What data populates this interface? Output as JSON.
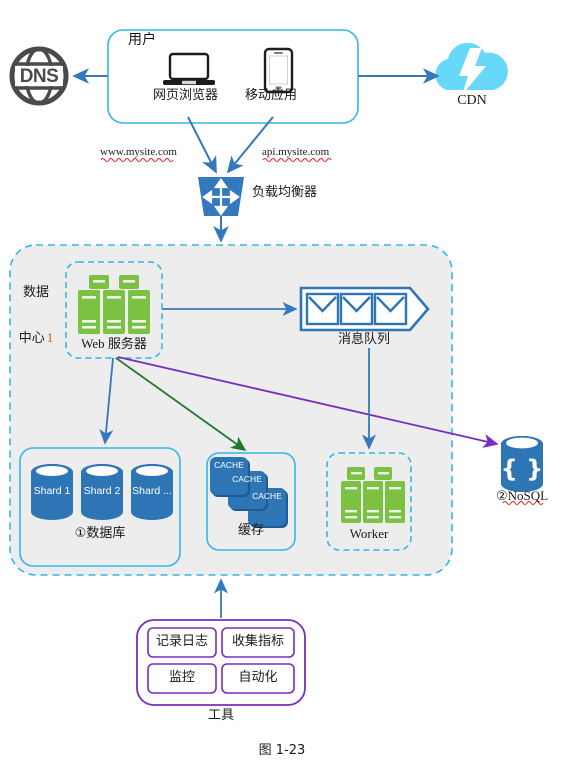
{
  "figure": {
    "caption": "图 1-23",
    "caption_prefix": "图",
    "caption_number": "1-23"
  },
  "colors": {
    "accent_blue": "#3478bd",
    "light_blue_border": "#35b6e8",
    "cyan_dashed": "#35b6e8",
    "server_green": "#7cc242",
    "db_blue": "#2e75b6",
    "cdn_cloud": "#67d8f8",
    "dns_gray": "#4a4a4a",
    "purple": "#7b2bbf",
    "green_arrow": "#1f7a30",
    "datacenter_fill": "#ededed",
    "spellcheck_red": "#e01b1b",
    "number_orange": "#c55a11"
  },
  "nodes": {
    "dns": {
      "label": "DNS",
      "icon": "globe-icon"
    },
    "users_group": {
      "title": "用户",
      "clients": [
        {
          "label": "网页浏览器",
          "icon": "laptop-icon"
        },
        {
          "label": "移动应用",
          "icon": "smartphone-icon"
        }
      ]
    },
    "cdn": {
      "label": "CDN",
      "icon": "cloud-lightning-icon"
    },
    "urls": [
      {
        "text": "www.mysite.com",
        "spellcheck_flag": true
      },
      {
        "text": "api.mysite.com",
        "spellcheck_flag": true
      }
    ],
    "load_balancer": {
      "label": "负载均衡器",
      "icon": "load-balancer-icon"
    },
    "datacenter": {
      "label_line1": "数据",
      "label_line2": "中心",
      "label_number": "1"
    },
    "web_server": {
      "label": "Web 服务器",
      "icon": "server-rack-icon"
    },
    "message_queue": {
      "label": "消息队列",
      "icon": "queue-envelopes-icon",
      "envelope_count": 3
    },
    "database": {
      "label": "①数据库",
      "marker": "①",
      "name": "数据库",
      "shards": [
        "Shard 1",
        "Shard 2",
        "Shard ..."
      ]
    },
    "cache": {
      "label": "缓存",
      "tiles": [
        "CACHE",
        "CACHE",
        "CACHE"
      ]
    },
    "worker": {
      "label": "Worker",
      "icon": "server-rack-icon"
    },
    "nosql": {
      "label": "②NoSQL",
      "marker": "②",
      "name": "NoSQL",
      "glyph": "{ }",
      "spellcheck_flag": true
    },
    "tools": {
      "label": "工具",
      "items": [
        "记录日志",
        "收集指标",
        "监控",
        "自动化"
      ]
    }
  },
  "edges": [
    {
      "from": "users_group",
      "to": "dns",
      "color": "#3478bd",
      "style": "solid"
    },
    {
      "from": "users_group",
      "to": "cdn",
      "color": "#3478bd",
      "style": "solid"
    },
    {
      "from": "网页浏览器",
      "to": "load_balancer",
      "color": "#3478bd",
      "style": "solid"
    },
    {
      "from": "移动应用",
      "to": "load_balancer",
      "color": "#3478bd",
      "style": "solid"
    },
    {
      "from": "load_balancer",
      "to": "datacenter",
      "color": "#3478bd",
      "style": "solid"
    },
    {
      "from": "web_server",
      "to": "message_queue",
      "color": "#3478bd",
      "style": "solid"
    },
    {
      "from": "web_server",
      "to": "database",
      "color": "#3478bd",
      "style": "solid"
    },
    {
      "from": "web_server",
      "to": "cache",
      "color": "#1f7a30",
      "style": "solid"
    },
    {
      "from": "web_server",
      "to": "nosql",
      "color": "#7b2bbf",
      "style": "solid"
    },
    {
      "from": "message_queue",
      "to": "worker",
      "color": "#3478bd",
      "style": "solid"
    },
    {
      "from": "tools",
      "to": "datacenter",
      "color": "#3478bd",
      "style": "solid"
    }
  ]
}
